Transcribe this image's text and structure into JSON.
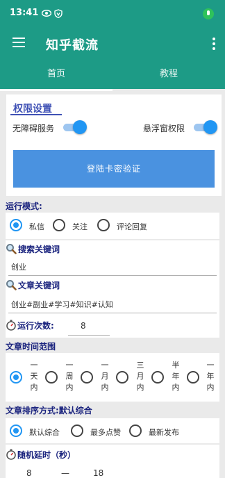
{
  "status_bar": {
    "time": "13:41"
  },
  "app_bar": {
    "title": "知乎截流"
  },
  "tabs": [
    {
      "label": "首页",
      "active": true
    },
    {
      "label": "教程",
      "active": false
    }
  ],
  "permissions": {
    "title": "权限设置",
    "accessibility": {
      "label": "无障碍服务",
      "enabled": true
    },
    "overlay": {
      "label": "悬浮窗权限",
      "enabled": true
    },
    "login_button": "登陆卡密验证"
  },
  "run_mode": {
    "label": "运行模式:",
    "options": [
      "私信",
      "关注",
      "评论回复"
    ],
    "selected": "私信"
  },
  "search_keyword": {
    "label": "搜索关键词",
    "value": "创业"
  },
  "article_keyword": {
    "label": "文章关键词",
    "value": "创业#副业#学习#知识#认知"
  },
  "run_count": {
    "label": "运行次数:",
    "value": "8"
  },
  "time_range": {
    "label": "文章时间范围",
    "options": [
      {
        "chars": [
          "一",
          "天",
          "内"
        ]
      },
      {
        "chars": [
          "一",
          "周",
          "内"
        ]
      },
      {
        "chars": [
          "一",
          "月",
          "内"
        ]
      },
      {
        "chars": [
          "三",
          "月",
          "内"
        ]
      },
      {
        "chars": [
          "半",
          "年",
          "内"
        ]
      },
      {
        "chars": [
          "一",
          "年",
          "内"
        ]
      }
    ],
    "selected_index": 0
  },
  "sort": {
    "label": "文章排序方式:默认综合",
    "options": [
      "默认综合",
      "最多点赞",
      "最新发布"
    ],
    "selected": "默认综合"
  },
  "delay": {
    "label": "随机延时（秒）",
    "min": "8",
    "separator": "—",
    "max": "18"
  },
  "colors": {
    "primary": "#1d9b86",
    "accent": "#2196f3",
    "section_text": "#1a237e",
    "button": "#4a92e0"
  }
}
